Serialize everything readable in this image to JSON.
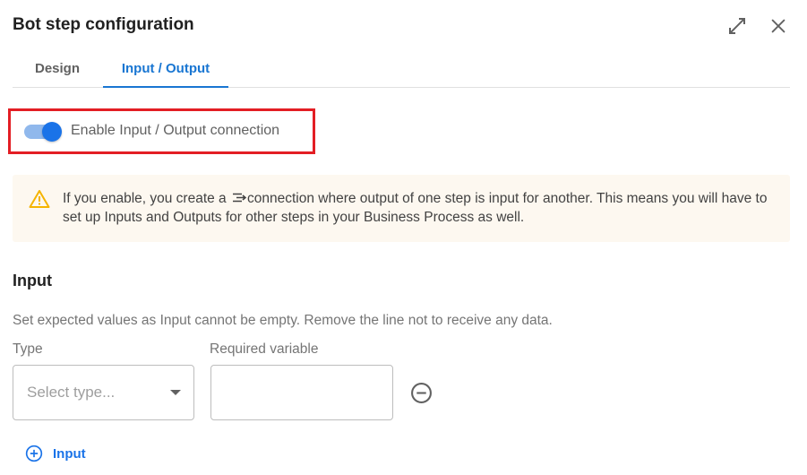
{
  "header": {
    "title": "Bot step configuration",
    "expand_icon": "expand-diagonal-icon",
    "close_icon": "close-icon"
  },
  "tabs": [
    {
      "label": "Design",
      "active": false
    },
    {
      "label": "Input / Output",
      "active": true
    }
  ],
  "toggle": {
    "label": "Enable Input / Output connection",
    "enabled": true
  },
  "warning": {
    "icon": "warning-triangle-icon",
    "text_before": "If you enable, you create a ",
    "inline_icon": "connection-icon",
    "text_after": "connection where output of one step is input for another. This means you will have to set up Inputs and Outputs for other steps in your Business Process as well."
  },
  "input_section": {
    "title": "Input",
    "description": "Set expected values as Input cannot be empty. Remove the line not to receive any data.",
    "type_label": "Type",
    "type_placeholder": "Select type...",
    "required_label": "Required variable",
    "required_value": "",
    "add_label": "Input"
  },
  "colors": {
    "accent": "#1a73e8",
    "highlight": "#e31e24",
    "warning_bg": "#fdf8f0",
    "warning_icon": "#f5b400"
  }
}
